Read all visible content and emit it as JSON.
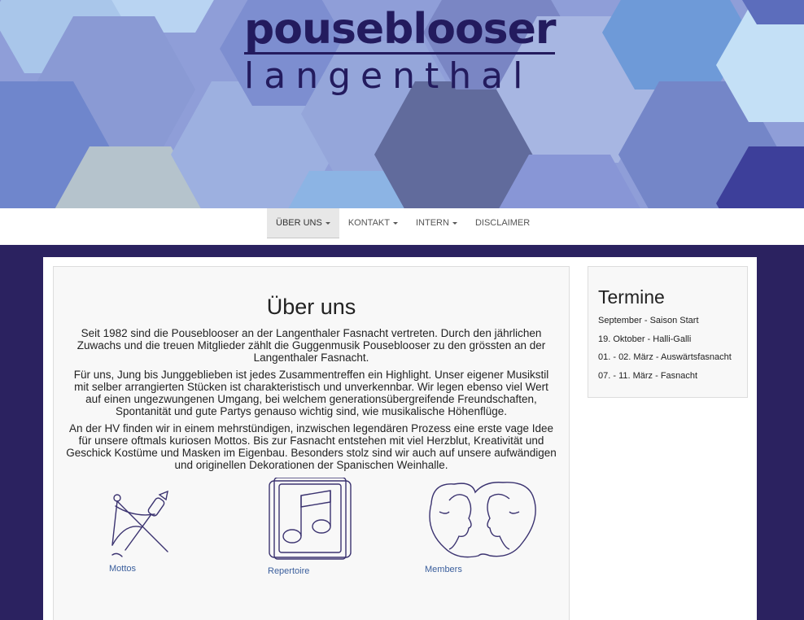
{
  "banner": {
    "logo_top": "pouseblooser",
    "logo_bottom": "langenthal"
  },
  "nav": {
    "items": [
      {
        "label": "ÜBER UNS",
        "dropdown": true,
        "active": true
      },
      {
        "label": "KONTAKT",
        "dropdown": true,
        "active": false
      },
      {
        "label": "INTERN",
        "dropdown": true,
        "active": false
      },
      {
        "label": "DISCLAIMER",
        "dropdown": false,
        "active": false
      }
    ]
  },
  "main": {
    "title": "Über uns",
    "paragraphs": [
      "Seit 1982 sind die Pouseblooser an der Langenthaler Fasnacht vertreten. Durch den jährlichen Zuwachs und die treuen Mitglieder zählt die Guggenmusik Pouseblooser zu den grössten an der Langenthaler Fasnacht.",
      "Für uns, Jung bis Junggeblieben ist jedes Zusammentreffen ein Highlight. Unser eigener Musikstil mit selber arrangierten Stücken ist charakteristisch und unverkennbar. Wir legen ebenso viel Wert auf einen ungezwungenen Umgang, bei welchem generationsübergreifende Freundschaften, Spontanität und gute Partys genauso wichtig sind, wie musikalische Höhenflüge.",
      "An der HV finden wir in einem mehrstündigen, inzwischen legendären Prozess eine erste vage Idee für unsere oftmals kuriosen Mottos. Bis zur Fasnacht entstehen mit viel Herzblut, Kreativität und Geschick Kostüme und Masken im Eigenbau. Besonders stolz sind wir auch auf unsere aufwändigen und originellen Dekorationen der Spanischen Weinhalle."
    ],
    "features": [
      {
        "label": "Mottos",
        "icon": "compass-brush-icon"
      },
      {
        "label": "Repertoire",
        "icon": "music-note-icon"
      },
      {
        "label": "Members",
        "icon": "faces-icon"
      }
    ]
  },
  "sidebar": {
    "title": "Termine",
    "items": [
      "September - Saison Start",
      "19. Oktober - Halli-Galli",
      "01. - 02. März - Auswärtsfasnacht",
      "07. - 11. März - Fasnacht"
    ]
  },
  "colors": {
    "page_background": "#2b2260",
    "logo": "#231b5e",
    "link": "#3a5e9c"
  }
}
